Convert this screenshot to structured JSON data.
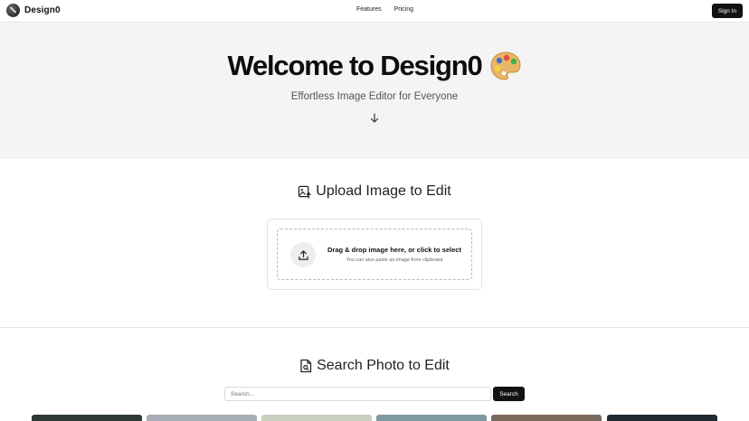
{
  "header": {
    "brand": "Design0",
    "nav": [
      "Features",
      "Pricing"
    ],
    "signin_label": "Sign In"
  },
  "hero": {
    "title": "Welcome to Design0",
    "subtitle": "Effortless Image Editor for Everyone",
    "title_icon": "palette-icon",
    "scroll_icon": "arrow-down-icon"
  },
  "upload": {
    "title": "Upload Image to Edit",
    "title_icon": "image-upload-icon",
    "drop_main": "Drag & drop image here, or click to select",
    "drop_sub": "You can also paste an image from clipboard",
    "drop_icon": "upload-icon"
  },
  "search": {
    "title": "Search Photo to Edit",
    "title_icon": "file-search-icon",
    "placeholder": "Search...",
    "button_label": "Search"
  },
  "photos": [
    {
      "color": "#2e3a33"
    },
    {
      "color": "#a7aeb5"
    },
    {
      "color": "#c9cfbf"
    },
    {
      "color": "#7e9aa0"
    },
    {
      "color": "#7a6a5e"
    },
    {
      "color": "#1f2a33"
    }
  ],
  "colors": {
    "accent": "#121212",
    "hero_bg": "#f4f4f4"
  }
}
